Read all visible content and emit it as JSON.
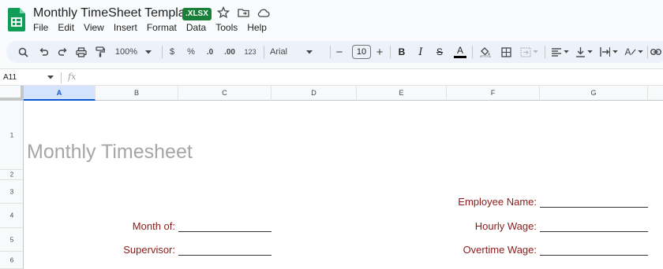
{
  "app": {
    "title": "Monthly TimeSheet Template",
    "badge": ".XLSX",
    "colors": {
      "badge_bg": "#188038",
      "logo_green": "#0f9d58",
      "label_red": "#8b1a1a",
      "title_gray": "#a6a6a6",
      "selected_header": "#d3e3fd"
    }
  },
  "menu": [
    "File",
    "Edit",
    "View",
    "Insert",
    "Format",
    "Data",
    "Tools",
    "Help"
  ],
  "toolbar": {
    "zoom": "100%",
    "currency": "$",
    "percent": "%",
    "dec_decrease": ".0",
    "dec_increase": ".00",
    "format_more": "123",
    "font": "Arial",
    "font_size": "10",
    "bold": "B",
    "italic": "I",
    "strike": "S",
    "text_color": "A",
    "icons": [
      "search-icon",
      "undo-icon",
      "redo-icon",
      "print-icon",
      "paint-format-icon",
      "bold-icon",
      "italic-icon",
      "strikethrough-icon",
      "text-color-icon",
      "fill-color-icon",
      "borders-icon",
      "merge-icon",
      "align-icon",
      "valign-icon",
      "text-wrap-icon",
      "text-rotate-icon",
      "link-icon"
    ]
  },
  "formula_bar": {
    "cell_ref": "A11",
    "fx": "fx"
  },
  "columns": [
    "A",
    "B",
    "C",
    "D",
    "E",
    "F",
    "G"
  ],
  "rows": [
    "1",
    "2",
    "3",
    "4",
    "5",
    "6"
  ],
  "sheet": {
    "title": "Monthly Timesheet",
    "employee_name_label": "Employee Name:",
    "month_of_label": "Month of:",
    "hourly_wage_label": "Hourly Wage:",
    "supervisor_label": "Supervisor:",
    "overtime_wage_label": "Overtime Wage:"
  }
}
